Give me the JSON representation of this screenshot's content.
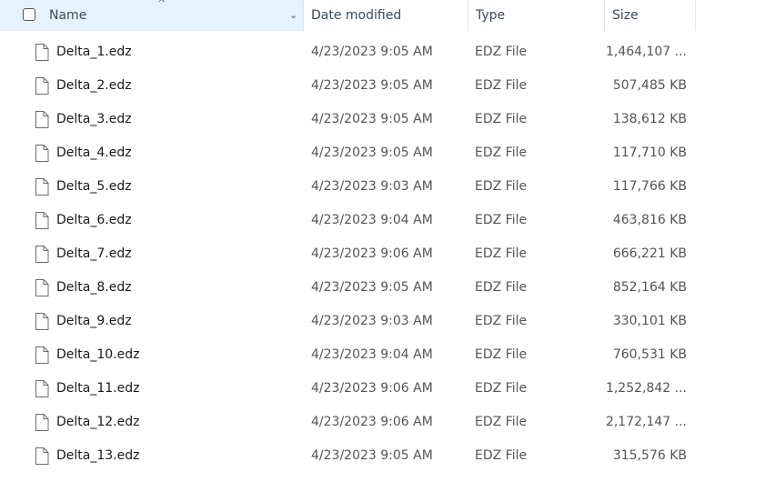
{
  "header": {
    "name": "Name",
    "date": "Date modified",
    "type": "Type",
    "size": "Size",
    "sort_arrow": "^",
    "dropdown": "⌄"
  },
  "rows": [
    {
      "name": "Delta_1.edz",
      "date": "4/23/2023 9:05 AM",
      "type": "EDZ File",
      "size": "1,464,107 ..."
    },
    {
      "name": "Delta_2.edz",
      "date": "4/23/2023 9:05 AM",
      "type": "EDZ File",
      "size": "507,485 KB"
    },
    {
      "name": "Delta_3.edz",
      "date": "4/23/2023 9:05 AM",
      "type": "EDZ File",
      "size": "138,612 KB"
    },
    {
      "name": "Delta_4.edz",
      "date": "4/23/2023 9:05 AM",
      "type": "EDZ File",
      "size": "117,710 KB"
    },
    {
      "name": "Delta_5.edz",
      "date": "4/23/2023 9:03 AM",
      "type": "EDZ File",
      "size": "117,766 KB"
    },
    {
      "name": "Delta_6.edz",
      "date": "4/23/2023 9:04 AM",
      "type": "EDZ File",
      "size": "463,816 KB"
    },
    {
      "name": "Delta_7.edz",
      "date": "4/23/2023 9:06 AM",
      "type": "EDZ File",
      "size": "666,221 KB"
    },
    {
      "name": "Delta_8.edz",
      "date": "4/23/2023 9:05 AM",
      "type": "EDZ File",
      "size": "852,164 KB"
    },
    {
      "name": "Delta_9.edz",
      "date": "4/23/2023 9:03 AM",
      "type": "EDZ File",
      "size": "330,101 KB"
    },
    {
      "name": "Delta_10.edz",
      "date": "4/23/2023 9:04 AM",
      "type": "EDZ File",
      "size": "760,531 KB"
    },
    {
      "name": "Delta_11.edz",
      "date": "4/23/2023 9:06 AM",
      "type": "EDZ File",
      "size": "1,252,842 ..."
    },
    {
      "name": "Delta_12.edz",
      "date": "4/23/2023 9:06 AM",
      "type": "EDZ File",
      "size": "2,172,147 ..."
    },
    {
      "name": "Delta_13.edz",
      "date": "4/23/2023 9:05 AM",
      "type": "EDZ File",
      "size": "315,576 KB"
    }
  ],
  "icons": {
    "file": "file-icon"
  },
  "colors": {
    "header_selected_bg": "#e5f3ff",
    "header_text": "#3c4a61"
  }
}
